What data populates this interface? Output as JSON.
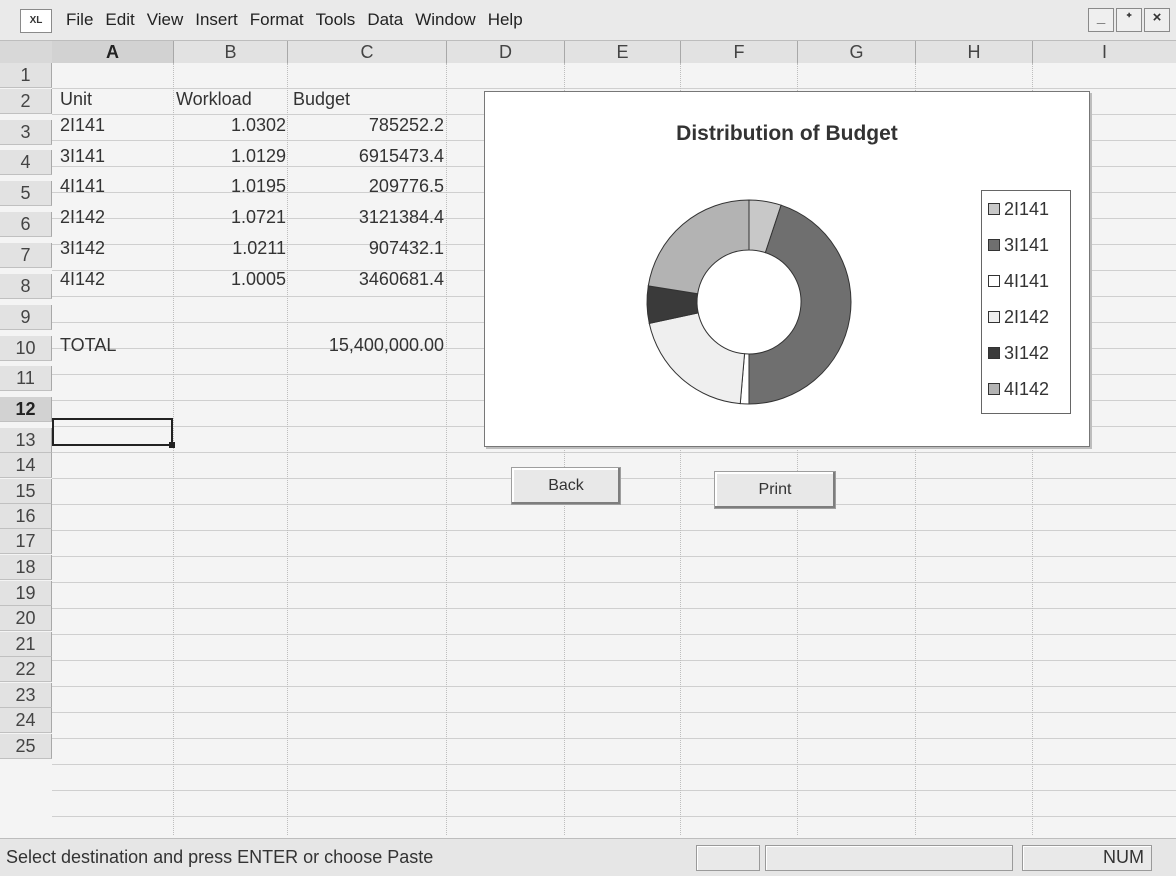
{
  "app_icon_label": "XL",
  "menu": [
    "File",
    "Edit",
    "View",
    "Insert",
    "Format",
    "Tools",
    "Data",
    "Window",
    "Help"
  ],
  "window_controls": {
    "minimize": "_",
    "restore": "ᐩ",
    "close": "×"
  },
  "columns": [
    "A",
    "B",
    "C",
    "D",
    "E",
    "F",
    "G",
    "H",
    "I"
  ],
  "rows": [
    "1",
    "2",
    "3",
    "4",
    "5",
    "6",
    "7",
    "8",
    "9",
    "10",
    "11",
    "12",
    "13",
    "14",
    "15",
    "16",
    "17",
    "18",
    "19",
    "20",
    "21",
    "22",
    "23",
    "24",
    "25"
  ],
  "table": {
    "headers": [
      "Unit",
      "Workload",
      "Budget"
    ],
    "rows": [
      [
        "2I141",
        "1.0302",
        "785252.2"
      ],
      [
        "3I141",
        "1.0129",
        "6915473.4"
      ],
      [
        "4I141",
        "1.0195",
        "209776.5"
      ],
      [
        "2I142",
        "1.0721",
        "3121384.4"
      ],
      [
        "3I142",
        "1.0211",
        "907432.1"
      ],
      [
        "4I142",
        "1.0005",
        "3460681.4"
      ]
    ],
    "total_label": "TOTAL",
    "total_value": "15,400,000.00"
  },
  "selected_cell": "A12",
  "chart_data": {
    "type": "pie",
    "variant": "doughnut",
    "title": "Distribution of Budget",
    "categories": [
      "2I141",
      "3I141",
      "4I141",
      "2I142",
      "3I142",
      "4I142"
    ],
    "values": [
      785252.2,
      6915473.4,
      209776.5,
      3121384.4,
      907432.1,
      3460681.4
    ],
    "legend": "right",
    "colors": [
      "#c8c8c8",
      "#6f6f6f",
      "#ffffff",
      "#efefef",
      "#3a3a3a",
      "#b3b3b3"
    ]
  },
  "buttons": {
    "back": "Back",
    "print": "Print"
  },
  "status": {
    "message": "Select destination and press ENTER or choose Paste",
    "num": "NUM"
  }
}
